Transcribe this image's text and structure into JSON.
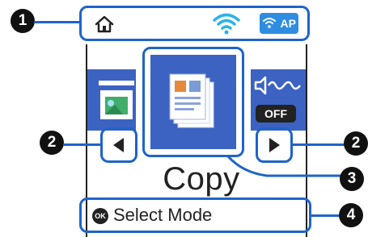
{
  "header": {
    "home_icon": "home-icon",
    "wifi_icon": "wifi-icon",
    "ap_badge_label": "AP"
  },
  "carousel": {
    "left_mode_icon": "photo-print-icon",
    "selected_mode_icon": "copy-icon",
    "right_mode_icon": "quiet-mode-icon",
    "right_mode_state": "OFF",
    "prev_icon": "arrow-left-icon",
    "next_icon": "arrow-right-icon"
  },
  "mode_label": "Copy",
  "footer": {
    "ok_label": "OK",
    "instruction": "Select Mode"
  },
  "callouts": [
    "1",
    "2",
    "2",
    "3",
    "4"
  ],
  "colors": {
    "highlight": "#1f63c9",
    "tile_blue": "#3c63c2",
    "ap_blue": "#2e8de0",
    "wifi_cyan": "#29b3e6"
  }
}
